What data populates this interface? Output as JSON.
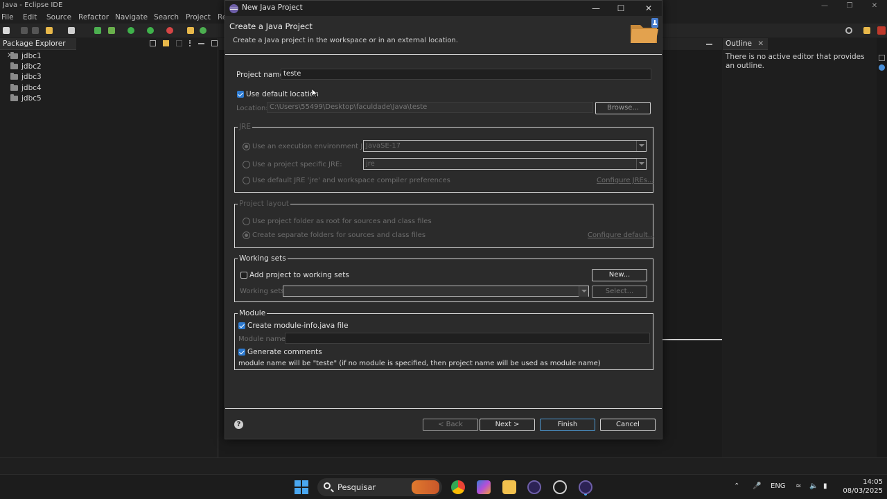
{
  "ide": {
    "window_title": "Java - Eclipse IDE",
    "menu": [
      "File",
      "Edit",
      "Source",
      "Refactor",
      "Navigate",
      "Search",
      "Project",
      "Re"
    ],
    "package_explorer": {
      "tab_label": "Package Explorer",
      "projects": [
        "jdbc1",
        "jdbc2",
        "jdbc3",
        "jdbc4",
        "jdbc5"
      ]
    },
    "outline": {
      "tab_label": "Outline",
      "message": "There is no active editor that provides an outline."
    }
  },
  "dialog": {
    "title": "New Java Project",
    "header_title": "Create a Java Project",
    "header_description": "Create a Java project in the workspace or in an external location.",
    "project_name_label": "Project name:",
    "project_name_value": "teste",
    "use_default_location_label": "Use default location",
    "use_default_location_checked": true,
    "location_label": "Location:",
    "location_value": "C:\\Users\\55499\\Desktop\\faculdade\\Java\\teste",
    "browse_label": "Browse...",
    "jre": {
      "group_label": "JRE",
      "opt_exec_env": "Use an execution environment JRE:",
      "exec_env_value": "JavaSE-17",
      "opt_project_specific": "Use a project specific JRE:",
      "project_specific_value": "jre",
      "opt_default_jre": "Use default JRE 'jre' and workspace compiler preferences",
      "configure_link": "Configure JREs..."
    },
    "project_layout": {
      "group_label": "Project layout",
      "opt_root": "Use project folder as root for sources and class files",
      "opt_separate": "Create separate folders for sources and class files",
      "configure_link": "Configure default..."
    },
    "working_sets": {
      "group_label": "Working sets",
      "add_label": "Add project to working sets",
      "add_checked": false,
      "new_button": "New...",
      "sets_label": "Working sets:",
      "select_button": "Select..."
    },
    "module": {
      "group_label": "Module",
      "create_label": "Create module-info.java file",
      "create_checked": true,
      "name_label": "Module name:",
      "generate_label": "Generate comments",
      "generate_checked": true,
      "note": "module name will be \"teste\"  (if no module is specified, then project name will be used as module name)"
    },
    "buttons": {
      "back": "< Back",
      "next": "Next >",
      "finish": "Finish",
      "cancel": "Cancel"
    }
  },
  "taskbar": {
    "search_placeholder": "Pesquisar",
    "language": "ENG",
    "time": "14:05",
    "date": "08/03/2025"
  },
  "colors": {
    "accent": "#2e7bd1",
    "dialog_bg": "#2b2b2b",
    "ide_bg": "#1f1f1f"
  }
}
